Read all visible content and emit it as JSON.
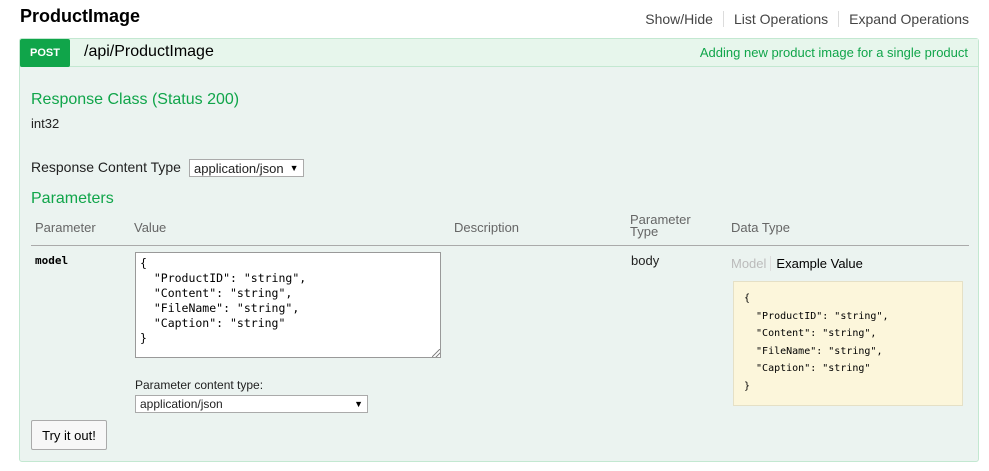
{
  "resource": {
    "title": "ProductImage",
    "links": [
      "Show/Hide",
      "List Operations",
      "Expand Operations"
    ]
  },
  "operation": {
    "method": "POST",
    "path": "/api/ProductImage",
    "summary": "Adding new product image for a single product",
    "response_class_title": "Response Class (Status 200)",
    "response_class_type": "int32",
    "response_content_type_label": "Response Content Type",
    "response_content_type_value": "application/json",
    "parameters_title": "Parameters",
    "table_headers": {
      "parameter": "Parameter",
      "value": "Value",
      "description": "Description",
      "parameter_type_line1": "Parameter",
      "parameter_type_line2": "Type",
      "data_type": "Data Type"
    },
    "param": {
      "name": "model",
      "value": "{\n  \"ProductID\": \"string\",\n  \"Content\": \"string\",\n  \"FileName\": \"string\",\n  \"Caption\": \"string\"\n}",
      "param_type": "body",
      "data_type_tabs": [
        "Model",
        "Example Value"
      ],
      "example_value": "{\n  \"ProductID\": \"string\",\n  \"Content\": \"string\",\n  \"FileName\": \"string\",\n  \"Caption\": \"string\"\n}",
      "content_type_label": "Parameter content type:",
      "content_type_value": "application/json"
    },
    "try_button_label": "Try it out!"
  },
  "colors": {
    "accent": "#10a54a",
    "panel_bg": "#ebf3f0",
    "example_bg": "#fcf6db"
  }
}
